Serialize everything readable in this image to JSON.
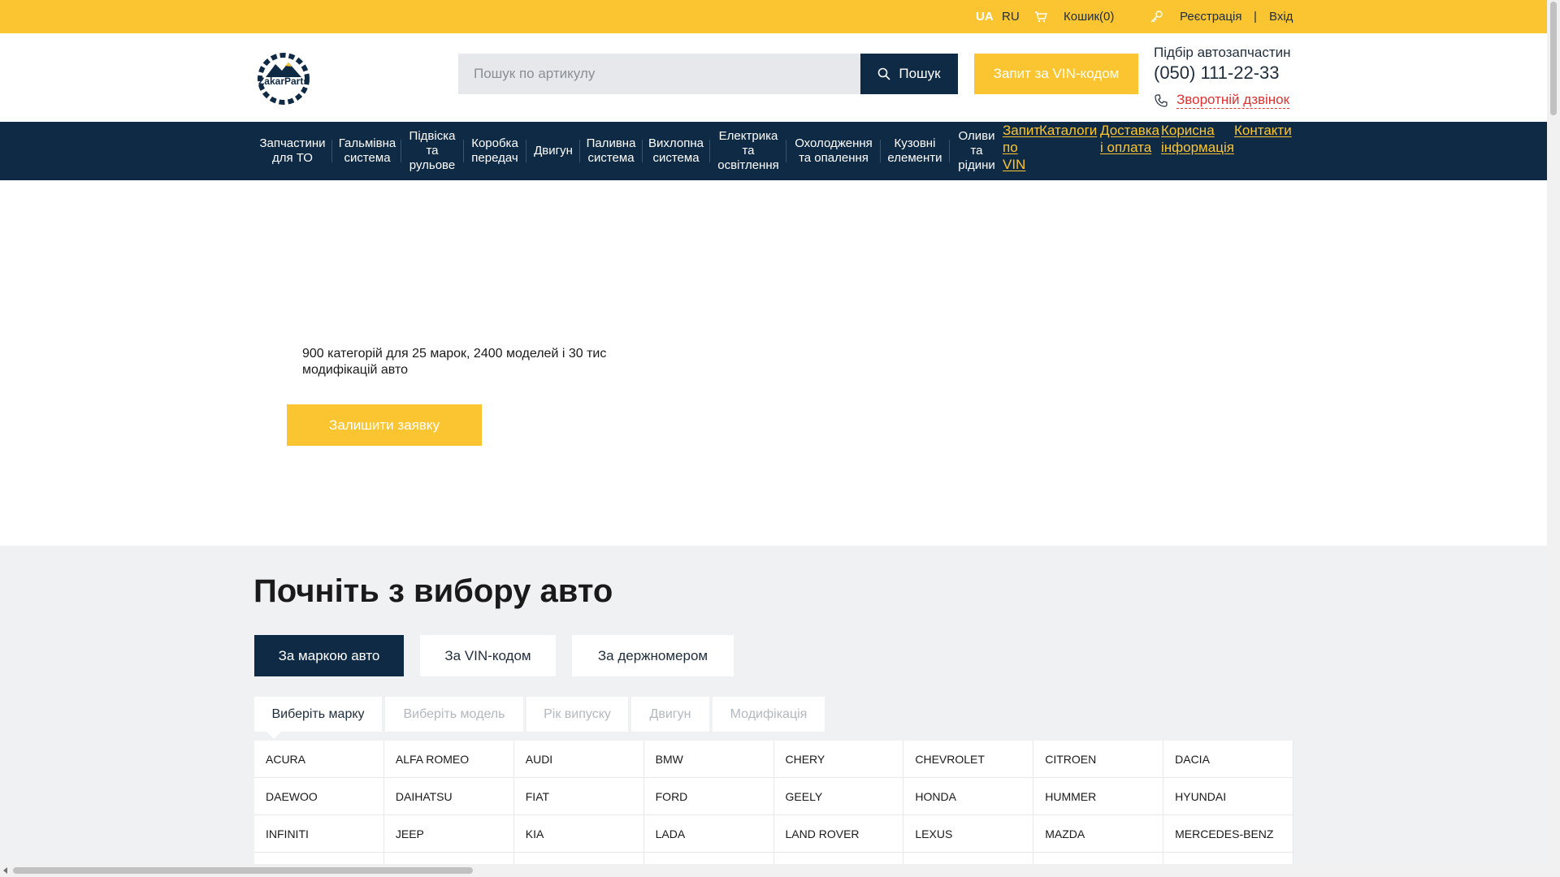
{
  "topbar": {
    "lang_active": "UA",
    "lang_other": "RU",
    "cart_label": "Кошик(0)",
    "register_label": "Реєстрація",
    "separator": "|",
    "login_label": "Вхід"
  },
  "header": {
    "logo_text": "ZakarParts",
    "search_placeholder": "Пошук по артикулу",
    "search_button": "Пошук",
    "vin_button": "Запит за VIN-кодом",
    "phone_title": "Підбір автозапчастин",
    "phone_number": "(050) 111-22-33",
    "callback_label": "Зворотній дзвінок"
  },
  "nav": {
    "items": [
      "Запчастини\nдля ТО",
      "Гальмівна\nсистема",
      "Підвіска\nта\nрульове",
      "Коробка\nпередач",
      "Двигун",
      "Паливна\nсистема",
      "Вихлопна\nсистема",
      "Електрика\nта\nосвітлення",
      "Охолодження\nта опалення",
      "Кузовні\nелементи",
      "Оливи\nта\nрідини"
    ],
    "links": [
      "Запит\nпо\nVIN",
      "Каталоги",
      "Доставка\nі оплата",
      "Корисна\nінформація",
      "Контакти"
    ]
  },
  "hero": {
    "text": "900 категорій для 25 марок, 2400 моделей і 30 тис модифікацій авто",
    "button": "Залишити заявку"
  },
  "selector": {
    "title": "Почніть з вибору авто",
    "tabs": [
      "За маркою авто",
      "За VIN-кодом",
      "За держномером"
    ],
    "steps": [
      "Виберіть марку",
      "Виберіть модель",
      "Рік випуску",
      "Двигун",
      "Модифікація"
    ],
    "brands": [
      "ACURA",
      "ALFA ROMEO",
      "AUDI",
      "BMW",
      "CHERY",
      "CHEVROLET",
      "CITROEN",
      "DACIA",
      "DAEWOO",
      "DAIHATSU",
      "FIAT",
      "FORD",
      "GEELY",
      "HONDA",
      "HUMMER",
      "HYUNDAI",
      "INFINITI",
      "JEEP",
      "KIA",
      "LADA",
      "LAND ROVER",
      "LEXUS",
      "MAZDA",
      "MERCEDES-BENZ"
    ]
  },
  "colors": {
    "accent": "#fbc531",
    "navy": "#0f2a45",
    "callback": "#e03131"
  }
}
